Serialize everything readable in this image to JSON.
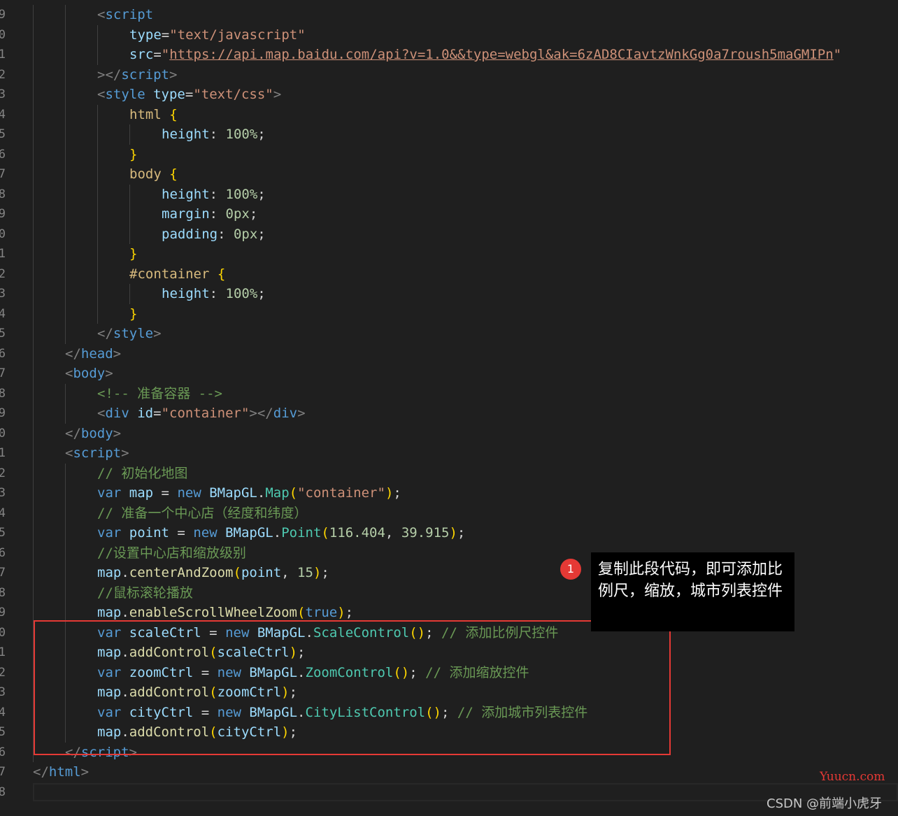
{
  "editor": {
    "gutter_numbers": [
      "9",
      "0",
      "1",
      "2",
      "3",
      "4",
      "5",
      "6",
      "7",
      "8",
      "9",
      "0",
      "1",
      "2",
      "3",
      "4",
      "5",
      "6",
      "7",
      "8",
      "9",
      "0",
      "1",
      "2",
      "3",
      "4",
      "5",
      "6",
      "7",
      "8",
      "9",
      "0",
      "1",
      "2",
      "3",
      "4",
      "5",
      "6",
      "7",
      "8"
    ],
    "lines": [
      {
        "indent": 2,
        "tokens": [
          {
            "c": "t-punc",
            "t": "<"
          },
          {
            "c": "t-tag",
            "t": "script"
          }
        ]
      },
      {
        "indent": 3,
        "tokens": [
          {
            "c": "t-attr",
            "t": "type"
          },
          {
            "c": "t-txt",
            "t": "="
          },
          {
            "c": "t-str",
            "t": "\"text/javascript\""
          }
        ]
      },
      {
        "indent": 3,
        "tokens": [
          {
            "c": "t-attr",
            "t": "src"
          },
          {
            "c": "t-txt",
            "t": "="
          },
          {
            "c": "t-str",
            "t": "\""
          },
          {
            "c": "t-url",
            "t": "https://api.map.baidu.com/api?v=1.0&&type=webgl&ak=6zAD8CIavtzWnkGg0a7roush5maGMIPn"
          },
          {
            "c": "t-str",
            "t": "\""
          }
        ]
      },
      {
        "indent": 2,
        "tokens": [
          {
            "c": "t-punc",
            "t": "></"
          },
          {
            "c": "t-tag",
            "t": "script"
          },
          {
            "c": "t-punc",
            "t": ">"
          }
        ]
      },
      {
        "indent": 2,
        "tokens": [
          {
            "c": "t-punc",
            "t": "<"
          },
          {
            "c": "t-tag",
            "t": "style"
          },
          {
            "c": "t-txt",
            "t": " "
          },
          {
            "c": "t-attr",
            "t": "type"
          },
          {
            "c": "t-txt",
            "t": "="
          },
          {
            "c": "t-str",
            "t": "\"text/css\""
          },
          {
            "c": "t-punc",
            "t": ">"
          }
        ]
      },
      {
        "indent": 3,
        "tokens": [
          {
            "c": "t-sel",
            "t": "html"
          },
          {
            "c": "t-txt",
            "t": " "
          },
          {
            "c": "t-br",
            "t": "{"
          }
        ]
      },
      {
        "indent": 4,
        "tokens": [
          {
            "c": "t-prop",
            "t": "height"
          },
          {
            "c": "t-txt",
            "t": ": "
          },
          {
            "c": "t-num",
            "t": "100%"
          },
          {
            "c": "t-txt",
            "t": ";"
          }
        ]
      },
      {
        "indent": 3,
        "tokens": [
          {
            "c": "t-br",
            "t": "}"
          }
        ]
      },
      {
        "indent": 3,
        "tokens": [
          {
            "c": "t-sel",
            "t": "body"
          },
          {
            "c": "t-txt",
            "t": " "
          },
          {
            "c": "t-br",
            "t": "{"
          }
        ]
      },
      {
        "indent": 4,
        "tokens": [
          {
            "c": "t-prop",
            "t": "height"
          },
          {
            "c": "t-txt",
            "t": ": "
          },
          {
            "c": "t-num",
            "t": "100%"
          },
          {
            "c": "t-txt",
            "t": ";"
          }
        ]
      },
      {
        "indent": 4,
        "tokens": [
          {
            "c": "t-prop",
            "t": "margin"
          },
          {
            "c": "t-txt",
            "t": ": "
          },
          {
            "c": "t-num",
            "t": "0px"
          },
          {
            "c": "t-txt",
            "t": ";"
          }
        ]
      },
      {
        "indent": 4,
        "tokens": [
          {
            "c": "t-prop",
            "t": "padding"
          },
          {
            "c": "t-txt",
            "t": ": "
          },
          {
            "c": "t-num",
            "t": "0px"
          },
          {
            "c": "t-txt",
            "t": ";"
          }
        ]
      },
      {
        "indent": 3,
        "tokens": [
          {
            "c": "t-br",
            "t": "}"
          }
        ]
      },
      {
        "indent": 3,
        "tokens": [
          {
            "c": "t-sel",
            "t": "#container"
          },
          {
            "c": "t-txt",
            "t": " "
          },
          {
            "c": "t-br",
            "t": "{"
          }
        ]
      },
      {
        "indent": 4,
        "tokens": [
          {
            "c": "t-prop",
            "t": "height"
          },
          {
            "c": "t-txt",
            "t": ": "
          },
          {
            "c": "t-num",
            "t": "100%"
          },
          {
            "c": "t-txt",
            "t": ";"
          }
        ]
      },
      {
        "indent": 3,
        "tokens": [
          {
            "c": "t-br",
            "t": "}"
          }
        ]
      },
      {
        "indent": 2,
        "tokens": [
          {
            "c": "t-punc",
            "t": "</"
          },
          {
            "c": "t-tag",
            "t": "style"
          },
          {
            "c": "t-punc",
            "t": ">"
          }
        ]
      },
      {
        "indent": 1,
        "tokens": [
          {
            "c": "t-punc",
            "t": "</"
          },
          {
            "c": "t-tag",
            "t": "head"
          },
          {
            "c": "t-punc",
            "t": ">"
          }
        ]
      },
      {
        "indent": 1,
        "tokens": [
          {
            "c": "t-punc",
            "t": "<"
          },
          {
            "c": "t-tag",
            "t": "body"
          },
          {
            "c": "t-punc",
            "t": ">"
          }
        ]
      },
      {
        "indent": 2,
        "tokens": [
          {
            "c": "t-com",
            "t": "<!-- 准备容器 -->"
          }
        ]
      },
      {
        "indent": 2,
        "tokens": [
          {
            "c": "t-punc",
            "t": "<"
          },
          {
            "c": "t-tag",
            "t": "div"
          },
          {
            "c": "t-txt",
            "t": " "
          },
          {
            "c": "t-attr",
            "t": "id"
          },
          {
            "c": "t-txt",
            "t": "="
          },
          {
            "c": "t-str",
            "t": "\"container\""
          },
          {
            "c": "t-punc",
            "t": "></"
          },
          {
            "c": "t-tag",
            "t": "div"
          },
          {
            "c": "t-punc",
            "t": ">"
          }
        ]
      },
      {
        "indent": 1,
        "tokens": [
          {
            "c": "t-punc",
            "t": "</"
          },
          {
            "c": "t-tag",
            "t": "body"
          },
          {
            "c": "t-punc",
            "t": ">"
          }
        ]
      },
      {
        "indent": 1,
        "tokens": [
          {
            "c": "t-punc",
            "t": "<"
          },
          {
            "c": "t-tag",
            "t": "script"
          },
          {
            "c": "t-punc",
            "t": ">"
          }
        ]
      },
      {
        "indent": 2,
        "tokens": [
          {
            "c": "t-com",
            "t": "// 初始化地图"
          }
        ]
      },
      {
        "indent": 2,
        "tokens": [
          {
            "c": "t-kw",
            "t": "var"
          },
          {
            "c": "t-txt",
            "t": " "
          },
          {
            "c": "t-var",
            "t": "map"
          },
          {
            "c": "t-txt",
            "t": " = "
          },
          {
            "c": "t-kw",
            "t": "new"
          },
          {
            "c": "t-txt",
            "t": " "
          },
          {
            "c": "t-var",
            "t": "BMapGL"
          },
          {
            "c": "t-txt",
            "t": "."
          },
          {
            "c": "t-cls",
            "t": "Map"
          },
          {
            "c": "t-br",
            "t": "("
          },
          {
            "c": "t-str",
            "t": "\"container\""
          },
          {
            "c": "t-br",
            "t": ")"
          },
          {
            "c": "t-txt",
            "t": ";"
          }
        ]
      },
      {
        "indent": 2,
        "tokens": [
          {
            "c": "t-com",
            "t": "// 准备一个中心店（经度和纬度）"
          }
        ]
      },
      {
        "indent": 2,
        "tokens": [
          {
            "c": "t-kw",
            "t": "var"
          },
          {
            "c": "t-txt",
            "t": " "
          },
          {
            "c": "t-var",
            "t": "point"
          },
          {
            "c": "t-txt",
            "t": " = "
          },
          {
            "c": "t-kw",
            "t": "new"
          },
          {
            "c": "t-txt",
            "t": " "
          },
          {
            "c": "t-var",
            "t": "BMapGL"
          },
          {
            "c": "t-txt",
            "t": "."
          },
          {
            "c": "t-cls",
            "t": "Point"
          },
          {
            "c": "t-br",
            "t": "("
          },
          {
            "c": "t-num",
            "t": "116.404"
          },
          {
            "c": "t-txt",
            "t": ", "
          },
          {
            "c": "t-num",
            "t": "39.915"
          },
          {
            "c": "t-br",
            "t": ")"
          },
          {
            "c": "t-txt",
            "t": ";"
          }
        ]
      },
      {
        "indent": 2,
        "tokens": [
          {
            "c": "t-com",
            "t": "//设置中心店和缩放级别"
          }
        ]
      },
      {
        "indent": 2,
        "tokens": [
          {
            "c": "t-var",
            "t": "map"
          },
          {
            "c": "t-txt",
            "t": "."
          },
          {
            "c": "t-fn",
            "t": "centerAndZoom"
          },
          {
            "c": "t-br",
            "t": "("
          },
          {
            "c": "t-var",
            "t": "point"
          },
          {
            "c": "t-txt",
            "t": ", "
          },
          {
            "c": "t-num",
            "t": "15"
          },
          {
            "c": "t-br",
            "t": ")"
          },
          {
            "c": "t-txt",
            "t": ";"
          }
        ]
      },
      {
        "indent": 2,
        "tokens": [
          {
            "c": "t-com",
            "t": "//鼠标滚轮播放"
          }
        ]
      },
      {
        "indent": 2,
        "tokens": [
          {
            "c": "t-var",
            "t": "map"
          },
          {
            "c": "t-txt",
            "t": "."
          },
          {
            "c": "t-fn",
            "t": "enableScrollWheelZoom"
          },
          {
            "c": "t-br",
            "t": "("
          },
          {
            "c": "t-kw",
            "t": "true"
          },
          {
            "c": "t-br",
            "t": ")"
          },
          {
            "c": "t-txt",
            "t": ";"
          }
        ]
      },
      {
        "indent": 2,
        "tokens": [
          {
            "c": "t-kw",
            "t": "var"
          },
          {
            "c": "t-txt",
            "t": " "
          },
          {
            "c": "t-var",
            "t": "scaleCtrl"
          },
          {
            "c": "t-txt",
            "t": " = "
          },
          {
            "c": "t-kw",
            "t": "new"
          },
          {
            "c": "t-txt",
            "t": " "
          },
          {
            "c": "t-var",
            "t": "BMapGL"
          },
          {
            "c": "t-txt",
            "t": "."
          },
          {
            "c": "t-cls",
            "t": "ScaleControl"
          },
          {
            "c": "t-br",
            "t": "()"
          },
          {
            "c": "t-txt",
            "t": "; "
          },
          {
            "c": "t-com",
            "t": "// 添加比例尺控件"
          }
        ]
      },
      {
        "indent": 2,
        "tokens": [
          {
            "c": "t-var",
            "t": "map"
          },
          {
            "c": "t-txt",
            "t": "."
          },
          {
            "c": "t-fn",
            "t": "addControl"
          },
          {
            "c": "t-br",
            "t": "("
          },
          {
            "c": "t-var",
            "t": "scaleCtrl"
          },
          {
            "c": "t-br",
            "t": ")"
          },
          {
            "c": "t-txt",
            "t": ";"
          }
        ]
      },
      {
        "indent": 2,
        "tokens": [
          {
            "c": "t-kw",
            "t": "var"
          },
          {
            "c": "t-txt",
            "t": " "
          },
          {
            "c": "t-var",
            "t": "zoomCtrl"
          },
          {
            "c": "t-txt",
            "t": " = "
          },
          {
            "c": "t-kw",
            "t": "new"
          },
          {
            "c": "t-txt",
            "t": " "
          },
          {
            "c": "t-var",
            "t": "BMapGL"
          },
          {
            "c": "t-txt",
            "t": "."
          },
          {
            "c": "t-cls",
            "t": "ZoomControl"
          },
          {
            "c": "t-br",
            "t": "()"
          },
          {
            "c": "t-txt",
            "t": "; "
          },
          {
            "c": "t-com",
            "t": "// 添加缩放控件"
          }
        ]
      },
      {
        "indent": 2,
        "tokens": [
          {
            "c": "t-var",
            "t": "map"
          },
          {
            "c": "t-txt",
            "t": "."
          },
          {
            "c": "t-fn",
            "t": "addControl"
          },
          {
            "c": "t-br",
            "t": "("
          },
          {
            "c": "t-var",
            "t": "zoomCtrl"
          },
          {
            "c": "t-br",
            "t": ")"
          },
          {
            "c": "t-txt",
            "t": ";"
          }
        ]
      },
      {
        "indent": 2,
        "tokens": [
          {
            "c": "t-kw",
            "t": "var"
          },
          {
            "c": "t-txt",
            "t": " "
          },
          {
            "c": "t-var",
            "t": "cityCtrl"
          },
          {
            "c": "t-txt",
            "t": " = "
          },
          {
            "c": "t-kw",
            "t": "new"
          },
          {
            "c": "t-txt",
            "t": " "
          },
          {
            "c": "t-var",
            "t": "BMapGL"
          },
          {
            "c": "t-txt",
            "t": "."
          },
          {
            "c": "t-cls",
            "t": "CityListControl"
          },
          {
            "c": "t-br",
            "t": "()"
          },
          {
            "c": "t-txt",
            "t": "; "
          },
          {
            "c": "t-com",
            "t": "// 添加城市列表控件"
          }
        ]
      },
      {
        "indent": 2,
        "tokens": [
          {
            "c": "t-var",
            "t": "map"
          },
          {
            "c": "t-txt",
            "t": "."
          },
          {
            "c": "t-fn",
            "t": "addControl"
          },
          {
            "c": "t-br",
            "t": "("
          },
          {
            "c": "t-var",
            "t": "cityCtrl"
          },
          {
            "c": "t-br",
            "t": ")"
          },
          {
            "c": "t-txt",
            "t": ";"
          }
        ]
      },
      {
        "indent": 1,
        "tokens": [
          {
            "c": "t-punc",
            "t": "</"
          },
          {
            "c": "t-tag",
            "t": "script"
          },
          {
            "c": "t-punc",
            "t": ">"
          }
        ]
      },
      {
        "indent": 0,
        "tokens": [
          {
            "c": "t-punc",
            "t": "</"
          },
          {
            "c": "t-tag",
            "t": "html"
          },
          {
            "c": "t-punc",
            "t": ">"
          }
        ]
      },
      {
        "indent": 0,
        "tokens": []
      }
    ]
  },
  "annotation": {
    "badge_number": "1",
    "tooltip_text": "复制此段代码，即可添加比例尺，缩放，城市列表控件"
  },
  "watermarks": {
    "site": "Yuucn.com",
    "author": "CSDN @前端小虎牙"
  }
}
